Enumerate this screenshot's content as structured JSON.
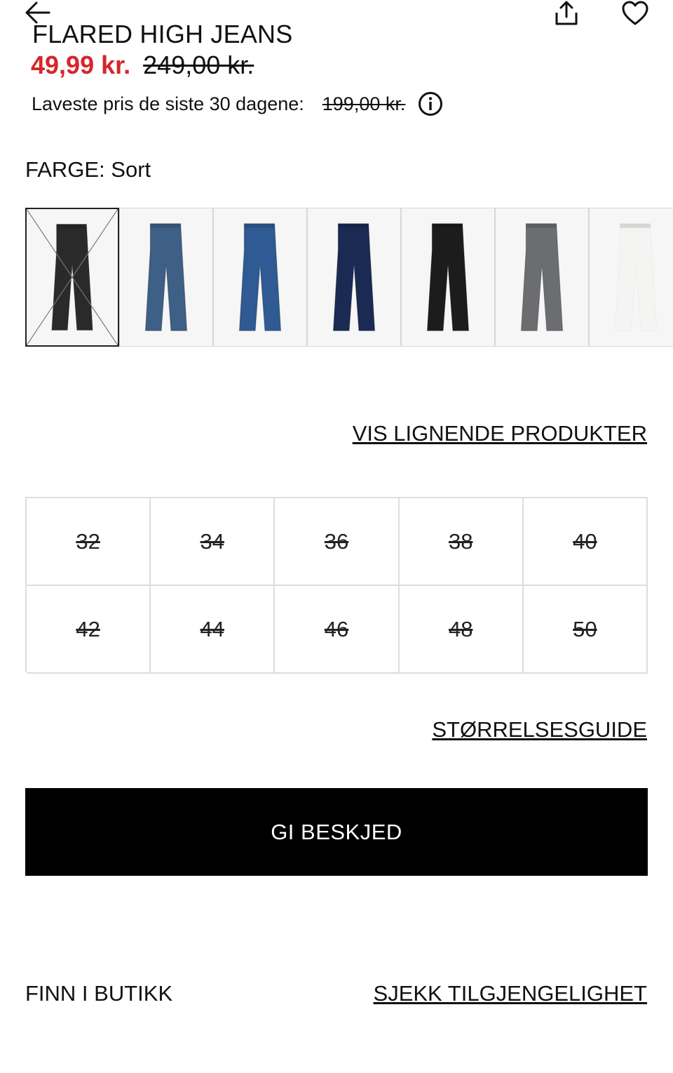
{
  "product": {
    "title": "FLARED HIGH JEANS",
    "price_sale": "49,99 kr.",
    "price_original": "249,00 kr.",
    "lowest_label": "Laveste pris de siste 30 dagene:",
    "lowest_value": "199,00 kr."
  },
  "color": {
    "label": "FARGE: Sort",
    "swatches": [
      {
        "name": "black-leather",
        "color": "#2a2a2a",
        "selected": true,
        "unavailable": true
      },
      {
        "name": "mid-blue",
        "color": "#3e5f86",
        "selected": false
      },
      {
        "name": "blue",
        "color": "#2f5a93",
        "selected": false
      },
      {
        "name": "dark-blue",
        "color": "#1b2a52",
        "selected": false
      },
      {
        "name": "black",
        "color": "#1c1c1c",
        "selected": false
      },
      {
        "name": "grey",
        "color": "#6b6d71",
        "selected": false
      },
      {
        "name": "white",
        "color": "#f4f4f2",
        "selected": false
      }
    ]
  },
  "links": {
    "similar": "VIS LIGNENDE PRODUKTER",
    "size_guide": "STØRRELSESGUIDE",
    "find_in_store": "FINN I BUTIKK",
    "check_availability": "SJEKK TILGJENGELIGHET"
  },
  "sizes": [
    "32",
    "34",
    "36",
    "38",
    "40",
    "42",
    "44",
    "46",
    "48",
    "50"
  ],
  "actions": {
    "notify": "GI BESKJED"
  },
  "icons": {
    "back": "arrow-left-icon",
    "share": "share-icon",
    "favorite": "heart-icon",
    "info": "info-icon"
  }
}
